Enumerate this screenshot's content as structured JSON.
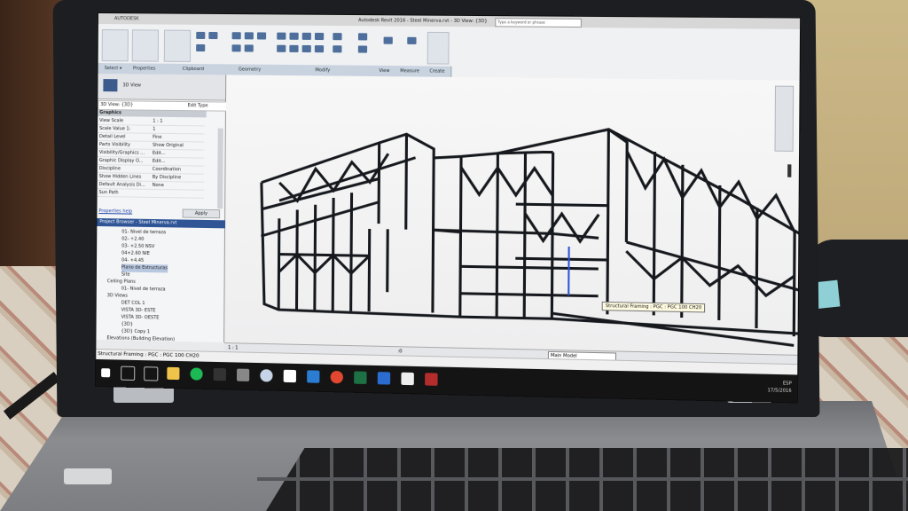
{
  "window": {
    "title": "Autodesk Revit 2016 - Steel Minerva.rvt - 3D View: {3D}",
    "search_placeholder": "Type a keyword or phrase",
    "app_logo": "AUTODESK"
  },
  "ribbon": {
    "panels": [
      "Select ▾",
      "Properties",
      "Clipboard",
      "Geometry",
      "Modify",
      "View",
      "Measure",
      "Create"
    ]
  },
  "properties": {
    "type_name": "3D View",
    "view_selector": "3D View: {3D}",
    "edit_type": "Edit Type",
    "section": "Graphics",
    "rows": [
      {
        "label": "View Scale",
        "value": "1 : 1"
      },
      {
        "label": "Scale Value 1:",
        "value": "1"
      },
      {
        "label": "Detail Level",
        "value": "Fine"
      },
      {
        "label": "Parts Visibility",
        "value": "Show Original"
      },
      {
        "label": "Visibility/Graphics ...",
        "value": "Edit..."
      },
      {
        "label": "Graphic Display O...",
        "value": "Edit..."
      },
      {
        "label": "Discipline",
        "value": "Coordination"
      },
      {
        "label": "Show Hidden Lines",
        "value": "By Discipline"
      },
      {
        "label": "Default Analysis Di...",
        "value": "None"
      },
      {
        "label": "Sun Path",
        "value": ""
      }
    ],
    "help_link": "Properties help",
    "apply": "Apply"
  },
  "project_browser": {
    "title": "Project Browser - Steel Minerva.rvt",
    "items": [
      {
        "label": "01- Nivel de terraza",
        "indent": 3,
        "selected": false
      },
      {
        "label": "02- +2.40",
        "indent": 3,
        "selected": false
      },
      {
        "label": "03- +2.50 NSV",
        "indent": 3,
        "selected": false
      },
      {
        "label": "04+2.60 NIE",
        "indent": 3,
        "selected": false
      },
      {
        "label": "04- +4.45",
        "indent": 3,
        "selected": false
      },
      {
        "label": "Plano de Estructuras",
        "indent": 3,
        "selected": true
      },
      {
        "label": "Site",
        "indent": 3,
        "selected": false
      },
      {
        "label": "Ceiling Plans",
        "indent": 1,
        "selected": false
      },
      {
        "label": "01- Nivel de terraza",
        "indent": 3,
        "selected": false
      },
      {
        "label": "3D Views",
        "indent": 1,
        "selected": false
      },
      {
        "label": "DET COL 1",
        "indent": 3,
        "selected": false
      },
      {
        "label": "VISTA 3D- ESTE",
        "indent": 3,
        "selected": false
      },
      {
        "label": "VISTA 3D- OESTE",
        "indent": 3,
        "selected": false
      },
      {
        "label": "{3D}",
        "indent": 3,
        "selected": false
      },
      {
        "label": "{3D} Copy 1",
        "indent": 3,
        "selected": false
      },
      {
        "label": "Elevations (Building Elevation)",
        "indent": 1,
        "selected": false
      }
    ]
  },
  "viewport": {
    "tooltip": "Structural Framing : PGC : PGC 100 CH20"
  },
  "view_control": {
    "scale": "1 : 1",
    "coords": ":0"
  },
  "status_bar": {
    "text": "Structural Framing : PGC : PGC 100 CH20",
    "model": "Main Model"
  },
  "taskbar": {
    "time": "",
    "date": "17/5/2016",
    "lang": "ESP"
  },
  "hp_logo": "hp"
}
